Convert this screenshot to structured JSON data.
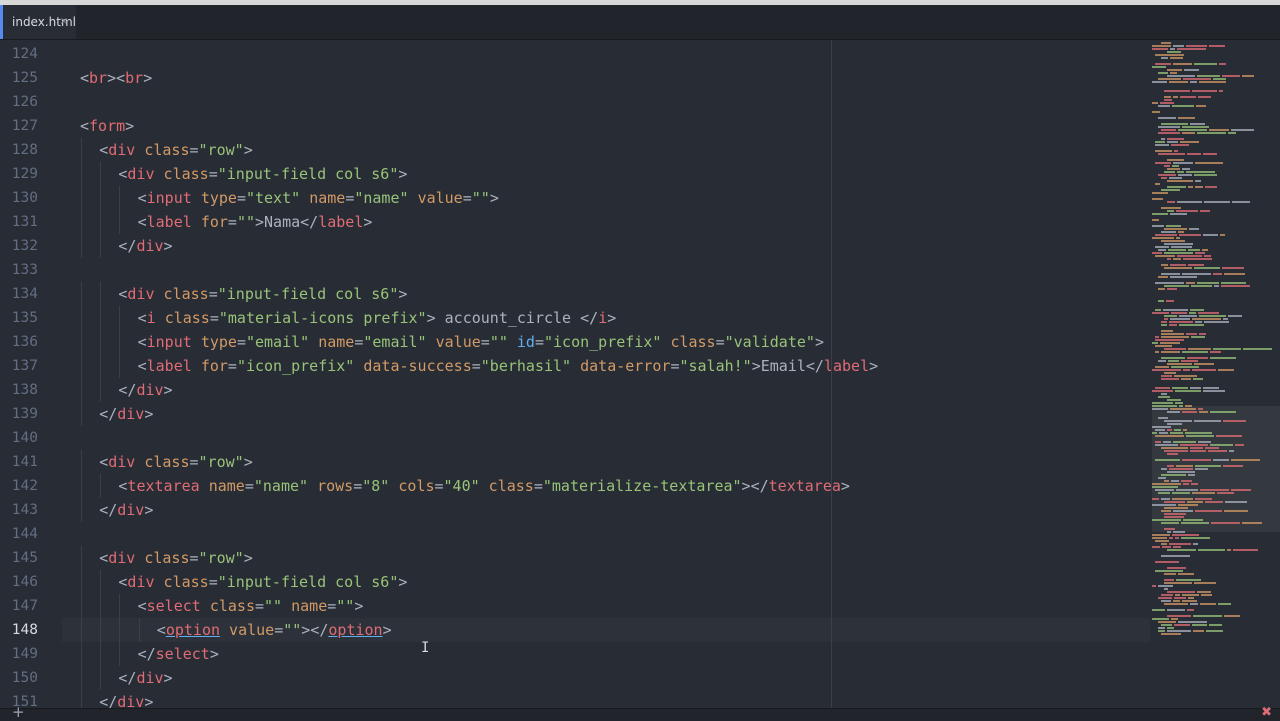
{
  "tabs": [
    {
      "label": "index.html",
      "close": "×"
    }
  ],
  "status": {
    "add": "+",
    "error": "✖"
  },
  "colors": {
    "background": "#282c34",
    "tag": "#e06c75",
    "attribute": "#d19a66",
    "string": "#98c379",
    "id_attribute": "#61afef",
    "text": "#abb2bf",
    "gutter": "#636d83"
  },
  "editor": {
    "active_line": 148,
    "lines": [
      {
        "number": "124",
        "indent": 0,
        "tokens": []
      },
      {
        "number": "125",
        "indent": 0,
        "tokens": [
          [
            "pun",
            "<"
          ],
          [
            "tag",
            "br"
          ],
          [
            "pun",
            "><"
          ],
          [
            "tag",
            "br"
          ],
          [
            "pun",
            ">"
          ]
        ]
      },
      {
        "number": "126",
        "indent": 0,
        "tokens": []
      },
      {
        "number": "127",
        "indent": 0,
        "tokens": [
          [
            "pun",
            "<"
          ],
          [
            "tag",
            "form"
          ],
          [
            "pun",
            ">"
          ]
        ]
      },
      {
        "number": "128",
        "indent": 1,
        "tokens": [
          [
            "pun",
            "<"
          ],
          [
            "tag",
            "div"
          ],
          [
            "pun",
            " "
          ],
          [
            "attr",
            "class"
          ],
          [
            "pun",
            "="
          ],
          [
            "str",
            "\"row\""
          ],
          [
            "pun",
            ">"
          ]
        ]
      },
      {
        "number": "129",
        "indent": 2,
        "tokens": [
          [
            "pun",
            "<"
          ],
          [
            "tag",
            "div"
          ],
          [
            "pun",
            " "
          ],
          [
            "attr",
            "class"
          ],
          [
            "pun",
            "="
          ],
          [
            "str",
            "\"input-field col s6\""
          ],
          [
            "pun",
            ">"
          ]
        ]
      },
      {
        "number": "130",
        "indent": 3,
        "tokens": [
          [
            "pun",
            "<"
          ],
          [
            "tag",
            "input"
          ],
          [
            "pun",
            " "
          ],
          [
            "attr",
            "type"
          ],
          [
            "pun",
            "="
          ],
          [
            "str",
            "\"text\""
          ],
          [
            "pun",
            " "
          ],
          [
            "attr",
            "name"
          ],
          [
            "pun",
            "="
          ],
          [
            "str",
            "\"name\""
          ],
          [
            "pun",
            " "
          ],
          [
            "attr",
            "value"
          ],
          [
            "pun",
            "="
          ],
          [
            "str",
            "\"\""
          ],
          [
            "pun",
            ">"
          ]
        ]
      },
      {
        "number": "131",
        "indent": 3,
        "tokens": [
          [
            "pun",
            "<"
          ],
          [
            "tag",
            "label"
          ],
          [
            "pun",
            " "
          ],
          [
            "attr",
            "for"
          ],
          [
            "pun",
            "="
          ],
          [
            "str",
            "\"\""
          ],
          [
            "pun",
            ">"
          ],
          [
            "txt",
            "Nama"
          ],
          [
            "pun",
            "</"
          ],
          [
            "tag",
            "label"
          ],
          [
            "pun",
            ">"
          ]
        ]
      },
      {
        "number": "132",
        "indent": 2,
        "tokens": [
          [
            "pun",
            "</"
          ],
          [
            "tag",
            "div"
          ],
          [
            "pun",
            ">"
          ]
        ]
      },
      {
        "number": "133",
        "indent": 0,
        "tokens": []
      },
      {
        "number": "134",
        "indent": 2,
        "tokens": [
          [
            "pun",
            "<"
          ],
          [
            "tag",
            "div"
          ],
          [
            "pun",
            " "
          ],
          [
            "attr",
            "class"
          ],
          [
            "pun",
            "="
          ],
          [
            "str",
            "\"input-field col s6\""
          ],
          [
            "pun",
            ">"
          ]
        ]
      },
      {
        "number": "135",
        "indent": 3,
        "tokens": [
          [
            "pun",
            "<"
          ],
          [
            "tag",
            "i"
          ],
          [
            "pun",
            " "
          ],
          [
            "attr",
            "class"
          ],
          [
            "pun",
            "="
          ],
          [
            "str",
            "\"material-icons prefix\""
          ],
          [
            "pun",
            ">"
          ],
          [
            "txt",
            " account_circle "
          ],
          [
            "pun",
            "</"
          ],
          [
            "tag",
            "i"
          ],
          [
            "pun",
            ">"
          ]
        ]
      },
      {
        "number": "136",
        "indent": 3,
        "tokens": [
          [
            "pun",
            "<"
          ],
          [
            "tag",
            "input"
          ],
          [
            "pun",
            " "
          ],
          [
            "attr",
            "type"
          ],
          [
            "pun",
            "="
          ],
          [
            "str",
            "\"email\""
          ],
          [
            "pun",
            " "
          ],
          [
            "attr",
            "name"
          ],
          [
            "pun",
            "="
          ],
          [
            "str",
            "\"email\""
          ],
          [
            "pun",
            " "
          ],
          [
            "attr",
            "value"
          ],
          [
            "pun",
            "="
          ],
          [
            "str",
            "\"\""
          ],
          [
            "pun",
            " "
          ],
          [
            "idattr",
            "id"
          ],
          [
            "pun",
            "="
          ],
          [
            "str",
            "\"icon_prefix\""
          ],
          [
            "pun",
            " "
          ],
          [
            "attr",
            "class"
          ],
          [
            "pun",
            "="
          ],
          [
            "str",
            "\"validate\""
          ],
          [
            "pun",
            ">"
          ]
        ]
      },
      {
        "number": "137",
        "indent": 3,
        "tokens": [
          [
            "pun",
            "<"
          ],
          [
            "tag",
            "label"
          ],
          [
            "pun",
            " "
          ],
          [
            "attr",
            "for"
          ],
          [
            "pun",
            "="
          ],
          [
            "str",
            "\"icon_prefix\""
          ],
          [
            "pun",
            " "
          ],
          [
            "attr",
            "data-success"
          ],
          [
            "pun",
            "="
          ],
          [
            "str",
            "\"berhasil\""
          ],
          [
            "pun",
            " "
          ],
          [
            "attr",
            "data-error"
          ],
          [
            "pun",
            "="
          ],
          [
            "str",
            "\"salah!\""
          ],
          [
            "pun",
            ">"
          ],
          [
            "txt",
            "Email"
          ],
          [
            "pun",
            "</"
          ],
          [
            "tag",
            "label"
          ],
          [
            "pun",
            ">"
          ]
        ]
      },
      {
        "number": "138",
        "indent": 2,
        "tokens": [
          [
            "pun",
            "</"
          ],
          [
            "tag",
            "div"
          ],
          [
            "pun",
            ">"
          ]
        ]
      },
      {
        "number": "139",
        "indent": 1,
        "tokens": [
          [
            "pun",
            "</"
          ],
          [
            "tag",
            "div"
          ],
          [
            "pun",
            ">"
          ]
        ]
      },
      {
        "number": "140",
        "indent": 0,
        "tokens": []
      },
      {
        "number": "141",
        "indent": 1,
        "tokens": [
          [
            "pun",
            "<"
          ],
          [
            "tag",
            "div"
          ],
          [
            "pun",
            " "
          ],
          [
            "attr",
            "class"
          ],
          [
            "pun",
            "="
          ],
          [
            "str",
            "\"row\""
          ],
          [
            "pun",
            ">"
          ]
        ]
      },
      {
        "number": "142",
        "indent": 2,
        "tokens": [
          [
            "pun",
            "<"
          ],
          [
            "tag",
            "textarea"
          ],
          [
            "pun",
            " "
          ],
          [
            "attr",
            "name"
          ],
          [
            "pun",
            "="
          ],
          [
            "str",
            "\"name\""
          ],
          [
            "pun",
            " "
          ],
          [
            "attr",
            "rows"
          ],
          [
            "pun",
            "="
          ],
          [
            "str",
            "\"8\""
          ],
          [
            "pun",
            " "
          ],
          [
            "attr",
            "cols"
          ],
          [
            "pun",
            "="
          ],
          [
            "str",
            "\"40\""
          ],
          [
            "pun",
            " "
          ],
          [
            "attr",
            "class"
          ],
          [
            "pun",
            "="
          ],
          [
            "str",
            "\"materialize-textarea\""
          ],
          [
            "pun",
            "></"
          ],
          [
            "tag",
            "textarea"
          ],
          [
            "pun",
            ">"
          ]
        ]
      },
      {
        "number": "143",
        "indent": 1,
        "tokens": [
          [
            "pun",
            "</"
          ],
          [
            "tag",
            "div"
          ],
          [
            "pun",
            ">"
          ]
        ]
      },
      {
        "number": "144",
        "indent": 0,
        "tokens": []
      },
      {
        "number": "145",
        "indent": 1,
        "tokens": [
          [
            "pun",
            "<"
          ],
          [
            "tag",
            "div"
          ],
          [
            "pun",
            " "
          ],
          [
            "attr",
            "class"
          ],
          [
            "pun",
            "="
          ],
          [
            "str",
            "\"row\""
          ],
          [
            "pun",
            ">"
          ]
        ]
      },
      {
        "number": "146",
        "indent": 2,
        "tokens": [
          [
            "pun",
            "<"
          ],
          [
            "tag",
            "div"
          ],
          [
            "pun",
            " "
          ],
          [
            "attr",
            "class"
          ],
          [
            "pun",
            "="
          ],
          [
            "str",
            "\"input-field col s6\""
          ],
          [
            "pun",
            ">"
          ]
        ]
      },
      {
        "number": "147",
        "indent": 3,
        "tokens": [
          [
            "pun",
            "<"
          ],
          [
            "tag",
            "select"
          ],
          [
            "pun",
            " "
          ],
          [
            "attr",
            "class"
          ],
          [
            "pun",
            "="
          ],
          [
            "str",
            "\"\""
          ],
          [
            "pun",
            " "
          ],
          [
            "attr",
            "name"
          ],
          [
            "pun",
            "="
          ],
          [
            "str",
            "\"\""
          ],
          [
            "pun",
            ">"
          ]
        ]
      },
      {
        "number": "148",
        "indent": 4,
        "tokens": [
          [
            "pun",
            "<"
          ],
          [
            "tagu",
            "option"
          ],
          [
            "pun",
            " "
          ],
          [
            "attr",
            "value"
          ],
          [
            "pun",
            "="
          ],
          [
            "str",
            "\"\""
          ],
          [
            "pun",
            "></"
          ],
          [
            "tagu",
            "option"
          ],
          [
            "pun",
            ">"
          ]
        ]
      },
      {
        "number": "149",
        "indent": 3,
        "tokens": [
          [
            "pun",
            "</"
          ],
          [
            "tag",
            "select"
          ],
          [
            "pun",
            ">"
          ]
        ]
      },
      {
        "number": "150",
        "indent": 2,
        "tokens": [
          [
            "pun",
            "</"
          ],
          [
            "tag",
            "div"
          ],
          [
            "pun",
            ">"
          ]
        ]
      },
      {
        "number": "151",
        "indent": 1,
        "tokens": [
          [
            "pun",
            "</"
          ],
          [
            "tag",
            "div"
          ],
          [
            "pun",
            ">"
          ]
        ]
      }
    ]
  }
}
